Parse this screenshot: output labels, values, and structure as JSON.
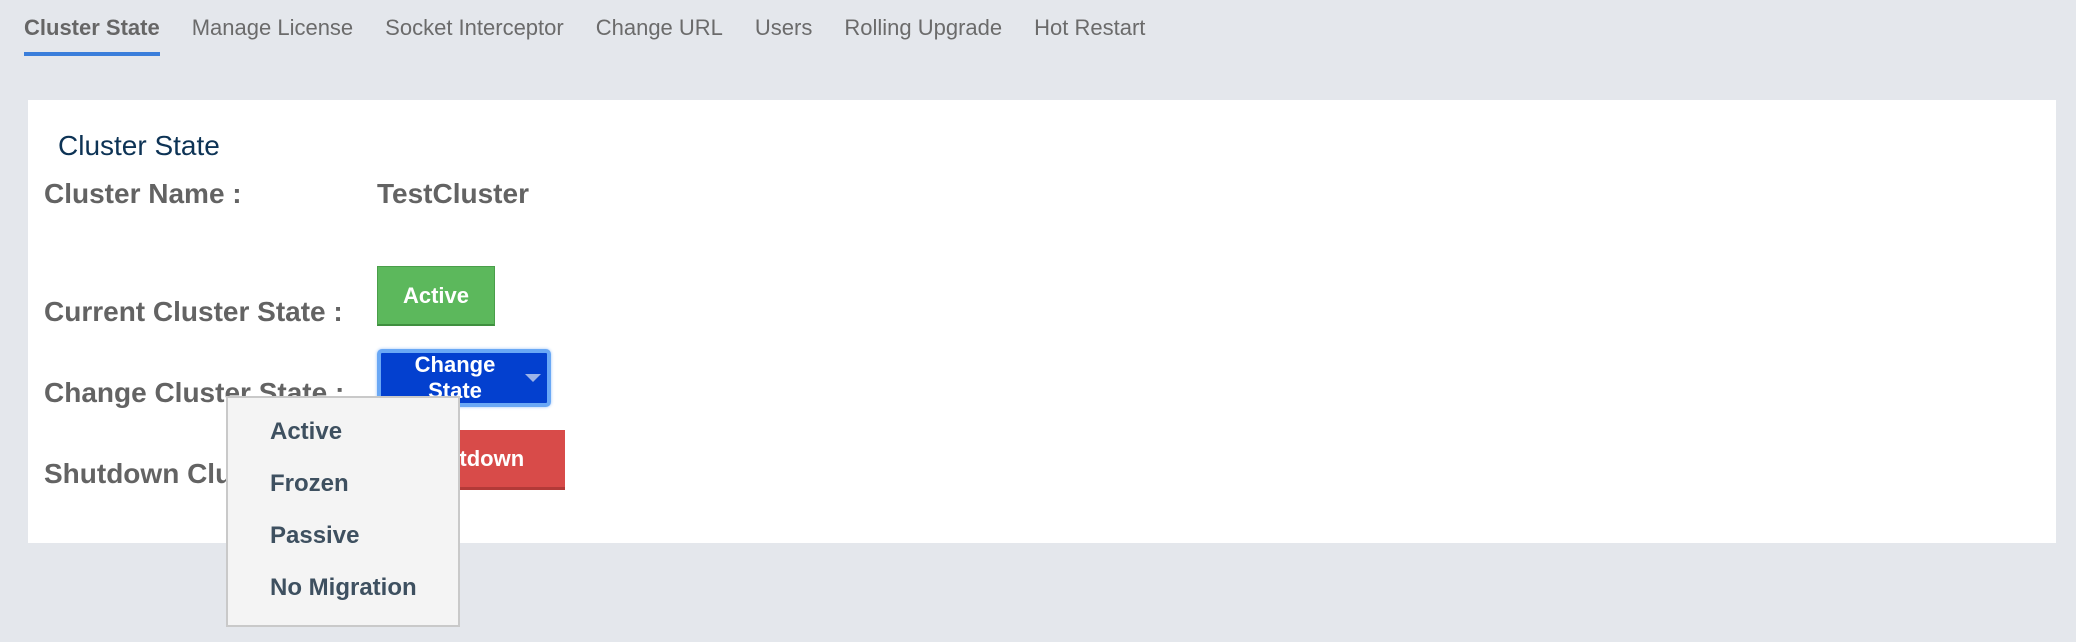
{
  "tabs": [
    {
      "label": "Cluster State",
      "active": true
    },
    {
      "label": "Manage License",
      "active": false
    },
    {
      "label": "Socket Interceptor",
      "active": false
    },
    {
      "label": "Change URL",
      "active": false
    },
    {
      "label": "Users",
      "active": false
    },
    {
      "label": "Rolling Upgrade",
      "active": false
    },
    {
      "label": "Hot Restart",
      "active": false
    }
  ],
  "panel": {
    "title": "Cluster State",
    "cluster_name_label": "Cluster Name :",
    "cluster_name_value": "TestCluster",
    "current_state_label": "Current Cluster State :",
    "current_state_value": "Active",
    "change_state_label": "Change Cluster State :",
    "change_state_button": "Change State",
    "shutdown_label": "Shutdown Cluster :",
    "shutdown_button": "Shutdown"
  },
  "dropdown": {
    "options": [
      "Active",
      "Frozen",
      "Passive",
      "No Migration"
    ]
  },
  "colors": {
    "accent": "#3a7edb",
    "active_state": "#5cb85c",
    "change_state": "#0340cf",
    "shutdown": "#d84b49"
  }
}
